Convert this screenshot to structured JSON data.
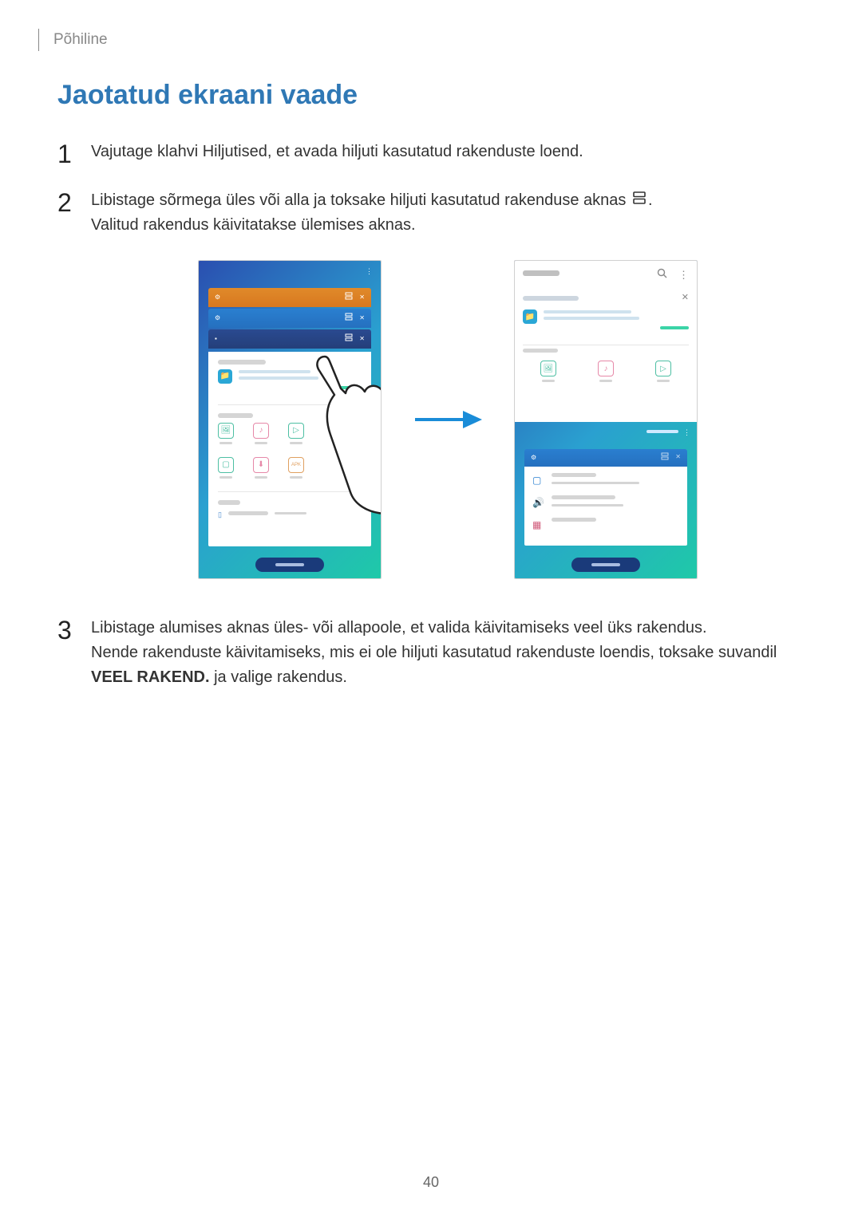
{
  "breadcrumb": "Põhiline",
  "section_title": "Jaotatud ekraani vaade",
  "steps": {
    "s1": "Vajutage klahvi Hiljutised, et avada hiljuti kasutatud rakenduste loend.",
    "s2a": "Libistage sõrmega üles või alla ja toksake hiljuti kasutatud rakenduse aknas ",
    "s2b": ".",
    "s2c": "Valitud rakendus käivitatakse ülemises aknas.",
    "s3a": "Libistage alumises aknas üles- või allapoole, et valida käivitamiseks veel üks rakendus.",
    "s3b_pre": "Nende rakenduste käivitamiseks, mis ei ole hiljuti kasutatud rakenduste loendis, toksake suvandil ",
    "s3b_bold": "VEEL RAKEND.",
    "s3b_post": " ja valige rakendus."
  },
  "page_number": "40"
}
